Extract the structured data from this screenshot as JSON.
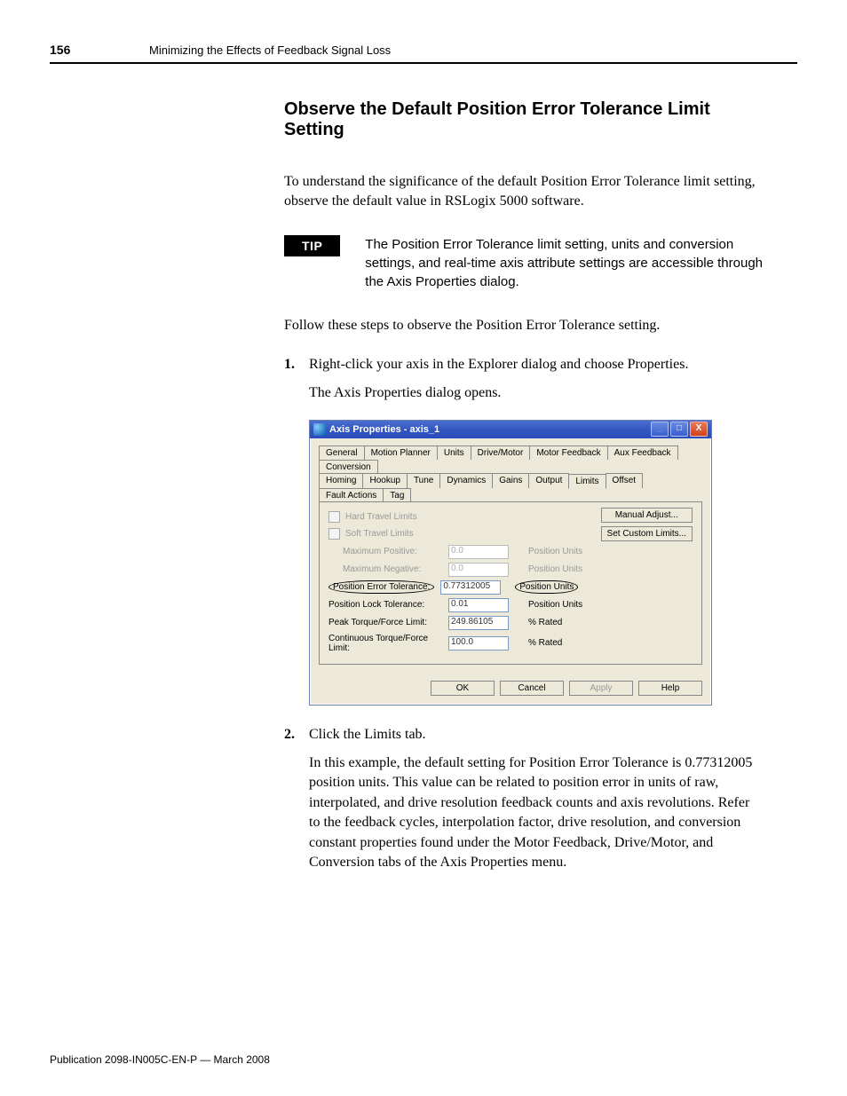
{
  "header": {
    "page_number": "156",
    "running_title": "Minimizing the Effects of Feedback Signal Loss"
  },
  "section": {
    "heading": "Observe the Default Position Error Tolerance Limit Setting",
    "intro": "To understand the significance of the default Position Error Tolerance limit setting, observe the default value in RSLogix 5000 software.",
    "tip_label": "TIP",
    "tip_text": "The Position Error Tolerance limit setting, units and conversion settings, and real-time axis attribute settings are accessible through the Axis Properties dialog.",
    "follow": "Follow these steps to observe the Position Error Tolerance setting.",
    "steps": [
      {
        "num": "1.",
        "text": "Right-click your axis in the Explorer dialog and choose Properties.",
        "sub": "The Axis Properties dialog opens."
      },
      {
        "num": "2.",
        "text": "Click the Limits tab.",
        "sub": "In this example, the default setting for Position Error Tolerance is 0.77312005 position units. This value can be related to position error in units of raw, interpolated, and drive resolution feedback counts and axis revolutions. Refer to the feedback cycles, interpolation factor, drive resolution, and conversion constant properties found under the Motor Feedback, Drive/Motor, and Conversion tabs of the Axis Properties menu."
      }
    ]
  },
  "dialog": {
    "title": "Axis Properties - axis_1",
    "tabs_row1": [
      "General",
      "Motion Planner",
      "Units",
      "Drive/Motor",
      "Motor Feedback",
      "Aux Feedback",
      "Conversion"
    ],
    "tabs_row2": [
      "Homing",
      "Hookup",
      "Tune",
      "Dynamics",
      "Gains",
      "Output",
      "Limits",
      "Offset",
      "Fault Actions",
      "Tag"
    ],
    "active_tab": "Limits",
    "chk_hard": "Hard Travel Limits",
    "chk_soft": "Soft Travel Limits",
    "fields": {
      "max_pos": {
        "label": "Maximum Positive:",
        "value": "0.0",
        "unit": "Position Units"
      },
      "max_neg": {
        "label": "Maximum Negative:",
        "value": "0.0",
        "unit": "Position Units"
      },
      "pet": {
        "label": "Position Error Tolerance:",
        "value": "0.77312005",
        "unit": "Position Units"
      },
      "plt": {
        "label": "Position Lock Tolerance:",
        "value": "0.01",
        "unit": "Position Units"
      },
      "ptfl": {
        "label": "Peak Torque/Force Limit:",
        "value": "249.86105",
        "unit": "% Rated"
      },
      "ctfl": {
        "label": "Continuous Torque/Force Limit:",
        "value": "100.0",
        "unit": "% Rated"
      }
    },
    "side_buttons": {
      "manual": "Manual Adjust...",
      "custom": "Set Custom Limits..."
    },
    "footer_buttons": {
      "ok": "OK",
      "cancel": "Cancel",
      "apply": "Apply",
      "help": "Help"
    }
  },
  "footer": "Publication 2098-IN005C-EN-P — March 2008"
}
